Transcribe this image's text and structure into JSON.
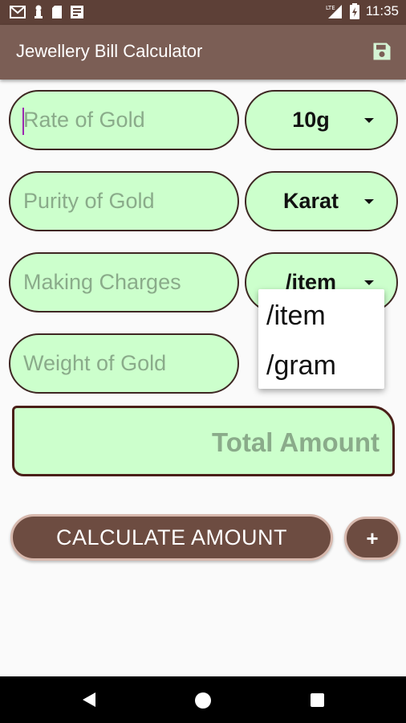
{
  "status_bar": {
    "time": "11:35",
    "icons_left": [
      "gmail-icon",
      "notification-icon",
      "sd-card-icon",
      "news-icon"
    ],
    "icons_right": [
      "signal-lte-icon",
      "battery-icon"
    ]
  },
  "app_bar": {
    "title": "Jewellery Bill Calculator",
    "action_icon": "save-icon"
  },
  "form": {
    "rate": {
      "placeholder": "Rate of Gold",
      "value": "",
      "unit_selected": "10g"
    },
    "purity": {
      "placeholder": "Purity of Gold",
      "value": "",
      "unit_selected": "Karat"
    },
    "making": {
      "placeholder": "Making Charges",
      "value": "",
      "unit_selected": "/item"
    },
    "weight": {
      "placeholder": "Weight of Gold",
      "value": ""
    }
  },
  "total": {
    "placeholder": "Total Amount"
  },
  "actions": {
    "calculate_label": "CALCULATE AMOUNT",
    "add_label": "+"
  },
  "dropdown": {
    "options": [
      "/item",
      "/gram"
    ]
  },
  "colors": {
    "primary_dark": "#5d4037",
    "primary": "#7b5e55",
    "field_bg": "#ccffcc",
    "button": "#6d4c41"
  }
}
